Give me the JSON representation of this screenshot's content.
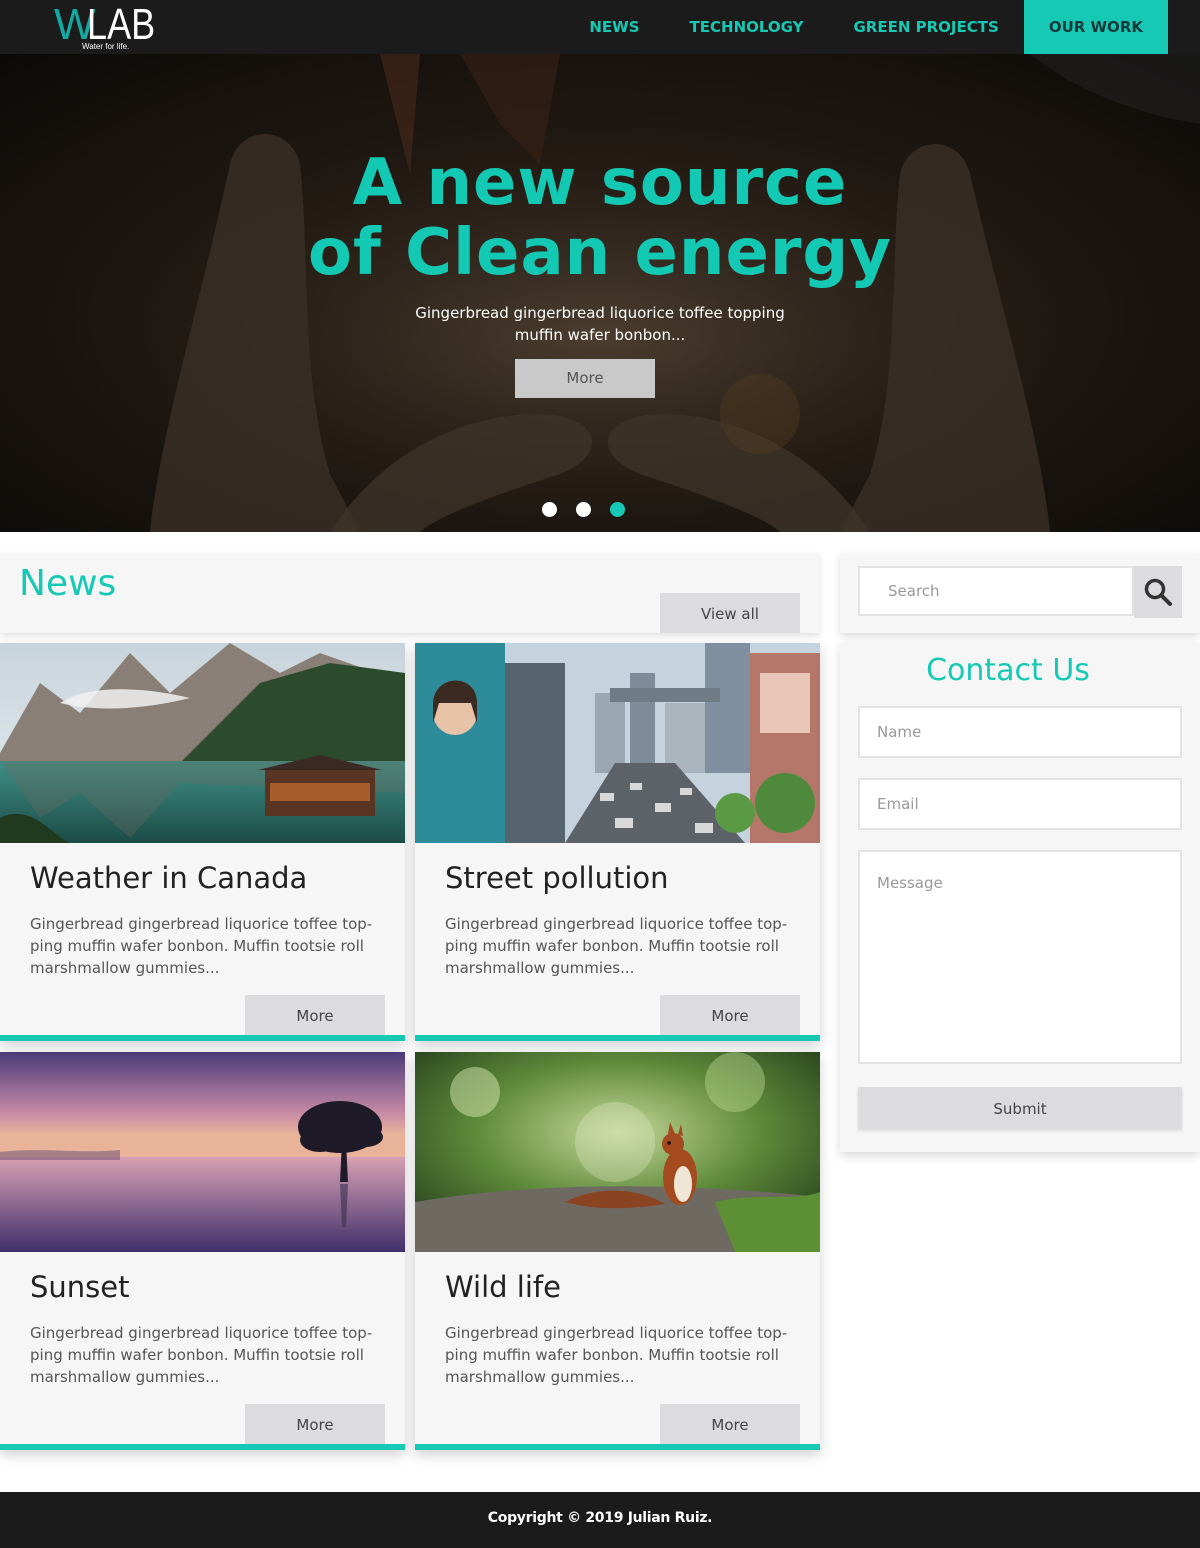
{
  "brand": {
    "logo_letter": "W",
    "logo_rest": "LAB",
    "tagline": "Water for life."
  },
  "nav": {
    "items": [
      {
        "label": "NEWS"
      },
      {
        "label": "TECHNOLOGY"
      },
      {
        "label": "GREEN PROJECTS"
      },
      {
        "label": "OUR WORK",
        "active": true
      }
    ]
  },
  "hero": {
    "title_line1": "A new source",
    "title_line2": "of Clean energy",
    "subtitle": "Gingerbread gingerbread liquorice toffee topping muffin wafer bonbon...",
    "button": "More",
    "slides": 3,
    "active_slide": 3
  },
  "news": {
    "title": "News",
    "view_all": "View all",
    "cards": [
      {
        "title": "Weather in Canada",
        "text": "Gingerbread gingerbread liquorice toffee top-ping muffin wafer bonbon. Muffin tootsie roll marshmallow gummies...",
        "button": "More",
        "image": "mountain-lake-image"
      },
      {
        "title": "Street pollution",
        "text": "Gingerbread gingerbread liquorice toffee top-ping muffin wafer bonbon. Muffin tootsie roll marshmallow gummies...",
        "button": "More",
        "image": "city-street-image"
      },
      {
        "title": "Sunset",
        "text": "Gingerbread gingerbread liquorice toffee top-ping muffin wafer bonbon. Muffin tootsie roll marshmallow gummies...",
        "button": "More",
        "image": "sunset-lake-image"
      },
      {
        "title": "Wild life",
        "text": "Gingerbread gingerbread liquorice toffee top-ping muffin wafer bonbon. Muffin tootsie roll marshmallow gummies...",
        "button": "More",
        "image": "squirrel-image"
      }
    ]
  },
  "search": {
    "placeholder": "Search",
    "icon": "search-icon"
  },
  "contact": {
    "title": "Contact Us",
    "name_placeholder": "Name",
    "email_placeholder": "Email",
    "message_placeholder": "Message",
    "submit": "Submit"
  },
  "footer": {
    "copyright": "Copyright © 2019 Julian Ruiz."
  },
  "colors": {
    "accent": "#16c9b4",
    "header_bg": "#1b1b1b",
    "card_bg": "#f6f6f6",
    "button_bg": "#dcdcde"
  }
}
